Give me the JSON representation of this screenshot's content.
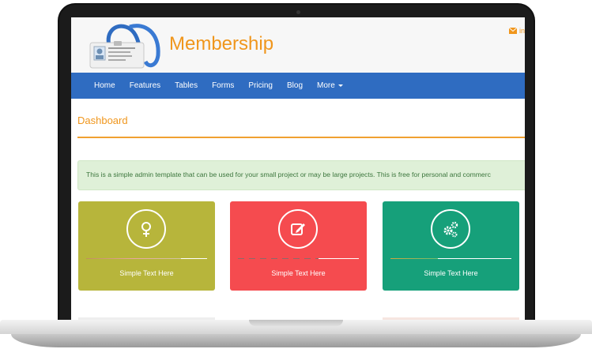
{
  "header": {
    "brand": "Membership",
    "mail_text": "in",
    "logo_icon": "id-badge-lanyard-icon"
  },
  "nav": {
    "items": [
      "Home",
      "Features",
      "Tables",
      "Forms",
      "Pricing",
      "Blog"
    ],
    "more_label": "More"
  },
  "page": {
    "title": "Dashboard",
    "alert_text": "This is a simple admin template that can be used for your small project or may be large projects. This is free for personal and commerc"
  },
  "cards": [
    {
      "label": "Simple Text Here",
      "icon": "female-icon",
      "color": "#b7b53b"
    },
    {
      "label": "Simple Text Here",
      "icon": "edit-icon",
      "color": "#f54b4f"
    },
    {
      "label": "Simple Text Here",
      "icon": "cogs-icon",
      "color": "#16a07a"
    }
  ],
  "colors": {
    "accent": "#f0961c",
    "nav": "#2f6cc1",
    "alert_bg": "#dff0d8",
    "alert_text": "#3c763d"
  }
}
